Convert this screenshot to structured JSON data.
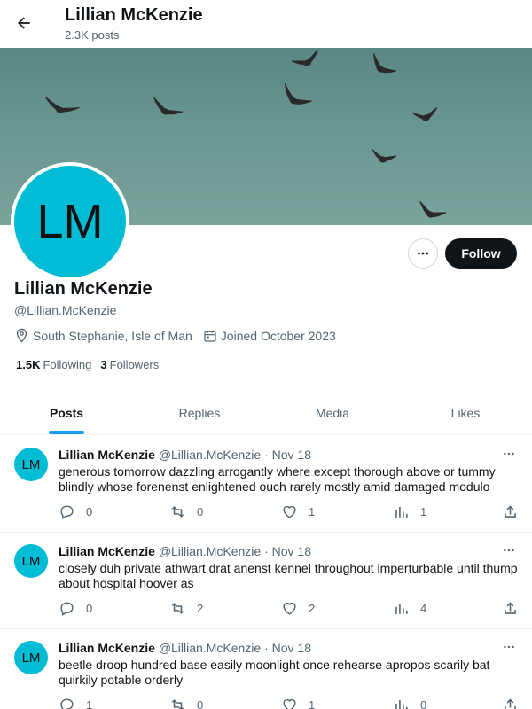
{
  "header": {
    "title": "Lillian McKenzie",
    "post_count": "2.3K posts"
  },
  "profile": {
    "avatar_initials": "LM",
    "name": "Lillian McKenzie",
    "handle": "@Lillian.McKenzie",
    "location": "South Stephanie, Isle of Man",
    "joined": "Joined October 2023",
    "following_count": "1.5K",
    "following_label": "Following",
    "followers_count": "3",
    "followers_label": "Followers",
    "follow_button": "Follow",
    "avatar_color": "#00bcd4"
  },
  "tabs": [
    {
      "label": "Posts",
      "active": true
    },
    {
      "label": "Replies",
      "active": false
    },
    {
      "label": "Media",
      "active": false
    },
    {
      "label": "Likes",
      "active": false
    }
  ],
  "posts": [
    {
      "initials": "LM",
      "name": "Lillian McKenzie",
      "handle": "@Lillian.McKenzie",
      "date": "· Nov 18",
      "text": "generous tomorrow dazzling arrogantly where except thorough above or tummy blindly whose forenenst enlightened ouch rarely mostly amid damaged modulo",
      "replies": "0",
      "reposts": "0",
      "likes": "1",
      "views": "1"
    },
    {
      "initials": "LM",
      "name": "Lillian McKenzie",
      "handle": "@Lillian.McKenzie",
      "date": "· Nov 18",
      "text": "closely duh private athwart drat anenst kennel throughout imperturbable until thump about hospital hoover as",
      "replies": "0",
      "reposts": "2",
      "likes": "2",
      "views": "4"
    },
    {
      "initials": "LM",
      "name": "Lillian McKenzie",
      "handle": "@Lillian.McKenzie",
      "date": "· Nov 18",
      "text": "beetle droop hundred base easily moonlight once rehearse apropos scarily bat quirkily potable orderly",
      "replies": "1",
      "reposts": "0",
      "likes": "1",
      "views": "0"
    }
  ],
  "colors": {
    "accent": "#1d9bf0",
    "text_primary": "#0f1419",
    "text_secondary": "#536471",
    "banner": "#6a9690"
  }
}
